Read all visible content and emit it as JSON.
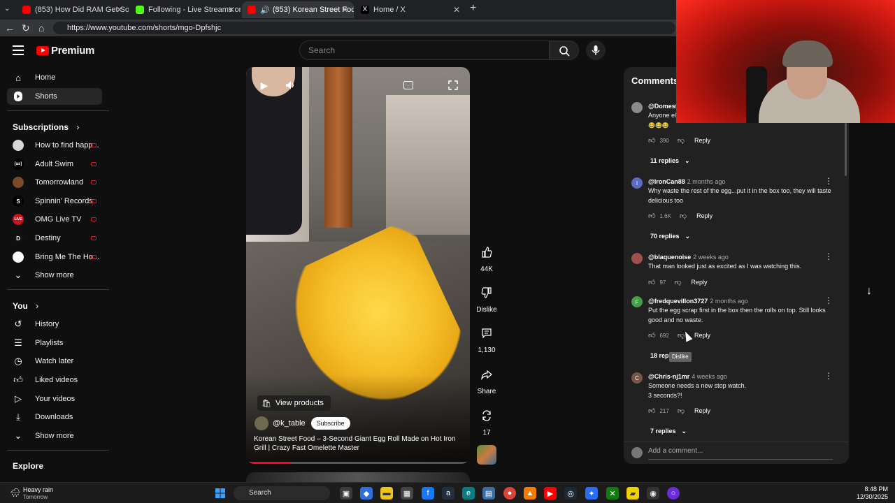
{
  "browser": {
    "tabs": [
      {
        "label": "(853) How Did RAM Get So Expen...",
        "color": "#ff0000"
      },
      {
        "label": "Following - Live Streams on Kick",
        "color": "#53fc18"
      },
      {
        "label": "(853) Korean Street Food – 3-...",
        "color": "#ff0000"
      },
      {
        "label": "Home / X",
        "color": "#ffffff"
      }
    ],
    "url": "https://www.youtube.com/shorts/mgo-Dpfshjc"
  },
  "header": {
    "logo": "Premium",
    "search_placeholder": "Search"
  },
  "sidebar": {
    "main": [
      {
        "label": "Home",
        "icon": "home-icon"
      },
      {
        "label": "Shorts",
        "icon": "shorts-icon"
      }
    ],
    "subscriptions_heading": "Subscriptions",
    "subscriptions": [
      {
        "label": "How to find happ...",
        "avatar_color": "#d8d8d8",
        "avatar_text": ""
      },
      {
        "label": "Adult Swim",
        "avatar_color": "#000000",
        "avatar_text": "[as]"
      },
      {
        "label": "Tomorrowland",
        "avatar_color": "#7a4a2a",
        "avatar_text": ""
      },
      {
        "label": "Spinnin' Records",
        "avatar_color": "#000000",
        "avatar_text": "S"
      },
      {
        "label": "OMG Live TV",
        "avatar_color": "#c4161c",
        "avatar_text": "LIVE"
      },
      {
        "label": "Destiny",
        "avatar_color": "#111111",
        "avatar_text": "D"
      },
      {
        "label": "Bring Me The Ho...",
        "avatar_color": "#ffffff",
        "avatar_text": ""
      }
    ],
    "show_more_1": "Show more",
    "you_heading": "You",
    "you": [
      {
        "label": "History",
        "icon": "history-icon"
      },
      {
        "label": "Playlists",
        "icon": "playlists-icon"
      },
      {
        "label": "Watch later",
        "icon": "watch-later-icon"
      },
      {
        "label": "Liked videos",
        "icon": "liked-videos-icon"
      },
      {
        "label": "Your videos",
        "icon": "your-videos-icon"
      },
      {
        "label": "Downloads",
        "icon": "downloads-icon"
      }
    ],
    "show_more_2": "Show more",
    "explore_heading": "Explore"
  },
  "video": {
    "view_products": "View products",
    "channel": "@k_table",
    "subscribe": "Subscribe",
    "title": "Korean Street Food – 3-Second Giant Egg Roll Made on Hot Iron Grill | Crazy Fast Omelette Master",
    "progress": 0.2
  },
  "actions": {
    "likes": "44K",
    "dislike": "Dislike",
    "comments": "1,130",
    "share": "Share",
    "remix": "17"
  },
  "comments": {
    "title": "Comments",
    "items": [
      {
        "author": "@Domesti",
        "time": "",
        "text": "Anyone el",
        "text2": "😂😂😂",
        "likes": "390",
        "reply": "Reply",
        "replies": "11 replies",
        "avatar_color": "#8a8a8a",
        "avatar_text": ""
      },
      {
        "author": "@IronCan88",
        "time": "2 months ago",
        "text": "Why waste the rest of the egg...put it in the box too, they will taste delicious too",
        "likes": "1.6K",
        "reply": "Reply",
        "replies": "70 replies",
        "avatar_color": "#5c6bc0",
        "avatar_text": "I"
      },
      {
        "author": "@blaquenoise",
        "time": "2 weeks ago",
        "text": "That man looked just as excited as I was watching this.",
        "likes": "97",
        "reply": "Reply",
        "replies": "",
        "avatar_color": "#a0524a",
        "avatar_text": ""
      },
      {
        "author": "@fredquevillon3727",
        "time": "2 months ago",
        "text": "Put the egg scrap first in the box then the rolls on top. Still looks good and no waste.",
        "likes": "692",
        "reply": "Reply",
        "replies": "18 rep",
        "avatar_color": "#43a047",
        "avatar_text": "F"
      },
      {
        "author": "@Chris-nj1mr",
        "time": "4 weeks ago",
        "text": "Someone needs a new stop watch.",
        "text2": "3 seconds?!",
        "likes": "217",
        "reply": "Reply",
        "replies": "7 replies",
        "avatar_color": "#795548",
        "avatar_text": "C"
      }
    ],
    "tooltip": "Dislike",
    "add_placeholder": "Add a comment..."
  },
  "taskbar": {
    "weather_title": "Heavy rain",
    "weather_sub": "Tomorrow",
    "search": "Search",
    "time": "8:48 PM",
    "date": "12/30/2025"
  }
}
